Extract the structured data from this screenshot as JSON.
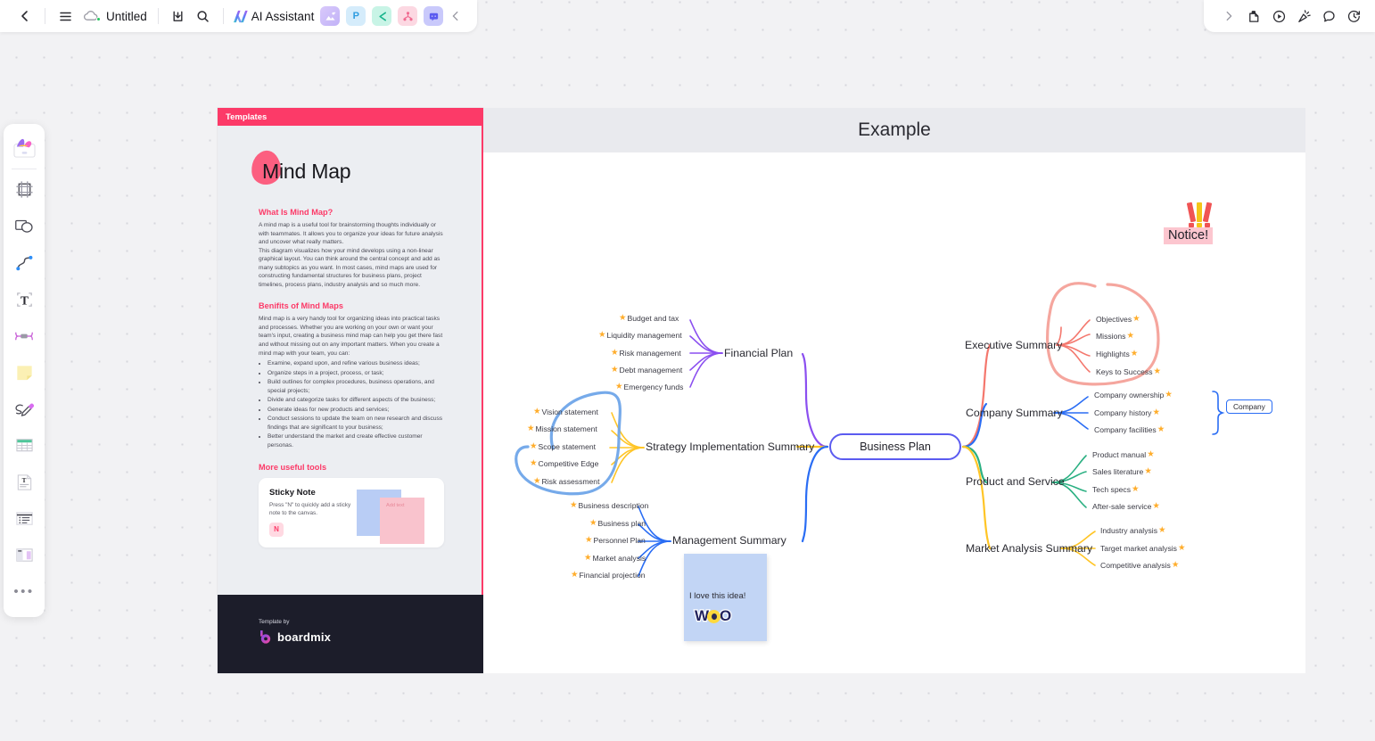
{
  "topbar": {
    "back_icon": "chevron-left-icon",
    "menu_icon": "hamburger-menu-icon",
    "cloud_icon": "cloud-saved-icon",
    "title": "Untitled",
    "download_icon": "download-icon",
    "search_icon": "search-icon",
    "ai_assistant_label": "AI Assistant",
    "app_chips": [
      {
        "name": "image-generate-chip",
        "glyph": "◢"
      },
      {
        "name": "presentation-chip",
        "glyph": "P"
      },
      {
        "name": "flowchart-chip",
        "glyph": "C"
      },
      {
        "name": "mindmap-chip",
        "glyph": "⑂"
      },
      {
        "name": "comment-chip",
        "glyph": "▣"
      }
    ],
    "collapse_icon": "chevron-left-icon"
  },
  "topbar_right": {
    "expand_icon": "chevron-right-icon",
    "icons": [
      {
        "name": "lock-note-icon"
      },
      {
        "name": "play-presentation-icon"
      },
      {
        "name": "celebrate-icon"
      },
      {
        "name": "comment-bubble-icon"
      },
      {
        "name": "timer-icon"
      }
    ]
  },
  "toolrail": {
    "items": [
      {
        "name": "tool-templates",
        "label": "Templates"
      },
      {
        "name": "tool-frame",
        "label": "Frame"
      },
      {
        "name": "tool-shape",
        "label": "Shape"
      },
      {
        "name": "tool-connector",
        "label": "Connector"
      },
      {
        "name": "tool-text",
        "label": "Text"
      },
      {
        "name": "tool-mindmap",
        "label": "Mind map"
      },
      {
        "name": "tool-sticky-note",
        "label": "Sticky note"
      },
      {
        "name": "tool-pen",
        "label": "Pen"
      },
      {
        "name": "tool-table",
        "label": "Table"
      },
      {
        "name": "tool-document",
        "label": "Document"
      },
      {
        "name": "tool-outline",
        "label": "Outline"
      },
      {
        "name": "tool-layout",
        "label": "Layout"
      }
    ],
    "more_label": "•••"
  },
  "template": {
    "header_label": "Templates",
    "title": "Mind Map",
    "sections": [
      {
        "heading": "What Is Mind Map?",
        "paragraphs": [
          "A mind map is a useful tool for brainstorming thoughts individually or with teammates. It allows you to organize your ideas for future analysis and uncover what really matters.",
          "This diagram visualizes how your mind develops using a non-linear graphical layout. You can think around the central concept and add as many subtopics as you want. In most cases, mind maps are used for constructing fundamental structures for business plans, project timelines, process plans, industry analysis and so much more."
        ]
      },
      {
        "heading": "Benifits of Mind Maps",
        "paragraphs": [
          "Mind map is a very handy tool for organizing ideas into practical tasks and processes. Whether you are working on your own or want your team's input, creating a business mind map can help you get there fast and without missing out on any important matters. When you create a mind map with your team, you can:"
        ],
        "bullets": [
          "Examine, expand upon, and refine various business ideas;",
          "Organize steps in a project, process, or task;",
          "Build outlines for complex procedures, business operations, and special projects;",
          "Divide and categorize tasks for different aspects of the business;",
          "Generate ideas for new products and services;",
          "Conduct sessions to update the team on new research and discuss findings that are significant to your business;",
          "Better understand the market and create effective customer personas."
        ]
      }
    ],
    "more_tools_heading": "More useful tools",
    "tool_card": {
      "title": "Sticky Note",
      "desc": "Press \"N\" to quickly add a sticky note to the canvas.",
      "key": "N",
      "note_placeholder": "Add text"
    },
    "footer": {
      "credit": "Template by",
      "brand": "boardmix"
    }
  },
  "frame": {
    "title": "Example"
  },
  "mindmap": {
    "central": "Business Plan",
    "branches": [
      {
        "name": "financial-plan",
        "label": "Financial Plan",
        "color": "#8b4ff0",
        "side": "left",
        "children": [
          "Budget and tax",
          "Liquidity management",
          "Risk management",
          "Debt management",
          "Emergency funds"
        ]
      },
      {
        "name": "strategy-implementation-summary",
        "label": "Strategy Implementation Summary",
        "color": "#ffc526",
        "side": "left",
        "children": [
          "Vision statement",
          "Mission statement",
          "Scope statement",
          "Competitive Edge",
          "Risk assessment"
        ]
      },
      {
        "name": "management-summary",
        "label": "Management Summary",
        "color": "#2a6df4",
        "side": "left",
        "children": [
          "Business description",
          "Business plan",
          "Personnel Plan",
          "Market analysis",
          "Financial  projection"
        ]
      },
      {
        "name": "executive-summary",
        "label": "Executive Summary",
        "color": "#f4776d",
        "side": "right",
        "children": [
          "Objectives",
          "Missions",
          "Highlights",
          "Keys to Success"
        ]
      },
      {
        "name": "company-summary",
        "label": "Company Summary",
        "color": "#2a6df4",
        "side": "right",
        "children": [
          "Company ownership",
          "Company history",
          "Company facilities"
        ]
      },
      {
        "name": "product-and-service",
        "label": "Product and Service",
        "color": "#2bb082",
        "side": "right",
        "children": [
          "Product manual",
          "Sales literature",
          "Tech specs",
          "After-sale service"
        ]
      },
      {
        "name": "market-analysis-summary",
        "label": "Market Analysis Summary",
        "color": "#ffc526",
        "side": "right",
        "children": [
          "Industry analysis",
          "Target market analysis",
          "Competitive analysis"
        ]
      }
    ],
    "bracket_label": "Company",
    "annotations": {
      "notice_text": "Notice!",
      "notice_highlight_color": "#fcc6cf",
      "red_circle_color": "#f4a199",
      "blue_circle_color": "#6aa3e8"
    }
  },
  "sticky_note": {
    "text": "I love this idea!",
    "sticker": "WOO",
    "color": "#c2d5f5"
  }
}
